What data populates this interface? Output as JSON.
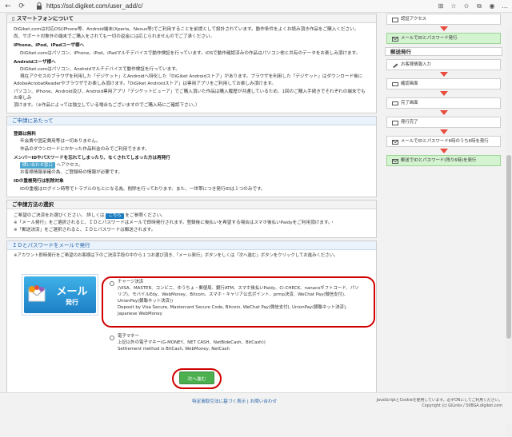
{
  "browser": {
    "url": "https://ssl.digiket.com/user_add/c/"
  },
  "sections": {
    "smartphone": {
      "title": "スマートフォンについて",
      "intro1": "DiGiket.comは対応OS(iPhone等、Android端末(Xperia、Nexus等)でご利用することを前提として設計されています。動作条件をよくお読み頂き作品をご購入ください。",
      "intro2": "尚、サポート対象外の端末でご購入をされても一切の返金には応じられませんのでご了承ください。",
      "iphone_h": "iPhone、iPod、iPadユーザ様へ",
      "iphone_t": "DiGiket.comはパソコン、iPhone、iPod、iPadマルチデバイスで動作検証を行っています。iOSで動作確認済みの作品はパソコン他と共有のデータをお楽しみ頂けます。",
      "android_h": "Androidユーザ様へ",
      "android_t1": "DiGiket.comはパソコン、Androidマルチデバイスで動作検証を行っています。",
      "android_t2": "現在アクセスのブラウザを利用した「デジケット」とAndroidへ特化した「DiGiket Androidストア」があります。ブラウザを利用した「デジケット」はダウンロード後に",
      "android_t3": "AdobeAcrobatReaderやブラウザでお楽しみ頂けます。「DiGiket Androidストア」は専用アプリをご利用してお楽しみ頂けます。",
      "android_store_link": "DiGiket Androidストア",
      "pc_t1": "パソコン、iPhone、Android及び、Android専用アプリ「デジケットビューア」でご購入頂いた作品は購入履歴が共通しているため、1回のご購入手続きでそれぞれの端末でもお楽しみ",
      "pc_t2": "頂けます。（※作品によっては独立している場合もございますのでご購入時にご確認下さい。）"
    },
    "apply": {
      "title": "ご申請にあたって",
      "free_h": "登録は無料",
      "free_t1": "年会費や固定費用等は一切ありません。",
      "free_t2": "作品のダウンロードにかかった作品料金のみでご利用できます。",
      "forgot_h": "メンバーIDやパスワードを忘れてしまったり、なくされてしまった方は再発行",
      "forgot_btn": "問い合わせ窓口",
      "forgot_t1": "へアクセス。",
      "forgot_t2": "お客様情報承確の為、ご登録時の情報が必要です。",
      "dup_h": "IDの重複発行は削除対象",
      "dup_t": "IDの重複はログイン時等でトラブルのもとになる為、削除を行っております。また、一世帯につき発行IDは１つのみです。"
    },
    "method": {
      "title": "ご申請方法の選択",
      "t1a": "ご希望のご決済をお選びください。 詳しくは",
      "t1_btn": "こちら",
      "t1b": "をご参照ください。",
      "t2": "※「メール発行」をご選択されると、ＩＤとパスワードはメールで即時発行されます。登録後に後払いを希望する場合はスマホ後払いPaidyをご利用頂けます。・",
      "t3": "※「郵送決済」をご選択されると、ＩＤとパスワードは郵送されます。"
    },
    "mail": {
      "title": "ＩＤとパスワードをメールで発行",
      "note": "※アカウント即時発行をご希望のお客様は下のご決済手段の中から１つお選び頂き、「メール発行」ボタンをしくは「次へ進む」ボタンをクリックしてお進みください。",
      "logo_big": "メール",
      "logo_small": "発行",
      "opt1_title": "チャージ決済",
      "opt1_l1": "(VISA、MASTER、コンビニ、ゆうちょ・郵便局、銀行ATM、スマホ後払いPaidy、Ci-CHECK、nanacoギフトコード、パソ",
      "opt1_l2": "リブ)、モバイルEdy、WebMoney、Bitcoin、スマホ・キャリア公式ポイント、prmp決済、WeChat Pay(微信支付)、",
      "opt1_l3": "UnionPay(銀聯ネット決済))",
      "opt1_l4": "Deposit by Visa Secure, Mastercard Secure Code, Bitcoin, WeChat Pay(微信支付), UnionPay(銀聯ネット決済),",
      "opt1_l5": "Japanese WebMoney",
      "opt2_title": "電子マネー",
      "opt2_l1": "上記以外の電子マネー(G-MONEY、NET CASH、NetBideCash、BitCash))",
      "opt2_l2": "Settlement method is BitCash, WebMoney, NetCash",
      "submit": "次へ進む"
    }
  },
  "sidebar": {
    "mail_flow": [
      "認証アクセス",
      "メールでIDとパスワード発行"
    ],
    "post_head": "郵送発行",
    "post_flow": [
      "お客様情報入力",
      "確認画面",
      "完了画面",
      "発行完了",
      "メールでIDとパスワード6時のうち6時を発行",
      "郵送でIDとパスワード(残り6時)を発行"
    ]
  },
  "footer": {
    "links": "特定商取引法に基づく表示 | お問い合わせ",
    "right1": "JavaScriptとCookieを使用しています。必ずONにしてご利用ください。",
    "right2": "Copyright (c) GiLinks / 50BGA.digiket.com"
  },
  "colors": {
    "accent": "#1f5fa8",
    "highlight": "#d10000",
    "submit": "#4caf50",
    "arrow": "#e74c3c",
    "flow_green": "#d4f4d1"
  }
}
